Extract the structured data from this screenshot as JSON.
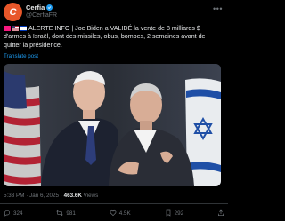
{
  "header": {
    "avatar_text": "C",
    "display_name": "Cerfia",
    "handle": "@CerfiaFR",
    "more_label": "•••"
  },
  "post": {
    "text": "ALERTE INFO | Joe Biden a VALIDÉ la vente de 8 milliards $ d'armes à Israël, dont des missiles, obus, bombes, 2 semaines avant de quitter la présidence.",
    "flags": [
      "alert-flag",
      "us-flag",
      "israel-flag"
    ],
    "translate_label": "Translate post"
  },
  "meta": {
    "time": "5:33 PM · Jan 6, 2025 · ",
    "views_count": "463.6K",
    "views_label": " Views"
  },
  "actions": {
    "reply_count": "324",
    "repost_count": "981",
    "like_count": "4.5K",
    "bookmark_count": "292"
  },
  "colors": {
    "background": "#000000",
    "text": "#e7e9ea",
    "muted": "#71767b",
    "accent": "#1d9bf0",
    "avatar": "#e8572a"
  }
}
